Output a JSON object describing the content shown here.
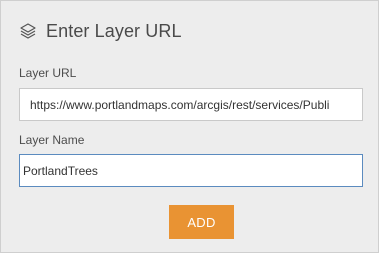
{
  "header": {
    "icon": "layers-icon",
    "title": "Enter Layer URL"
  },
  "form": {
    "url_label": "Layer URL",
    "url_value": "https://www.portlandmaps.com/arcgis/rest/services/Publi",
    "name_label": "Layer Name",
    "name_value": "PortlandTrees"
  },
  "actions": {
    "add_label": "ADD"
  },
  "colors": {
    "accent": "#e99333",
    "focus_border": "#5b8bbf",
    "panel_bg": "#ededed"
  }
}
